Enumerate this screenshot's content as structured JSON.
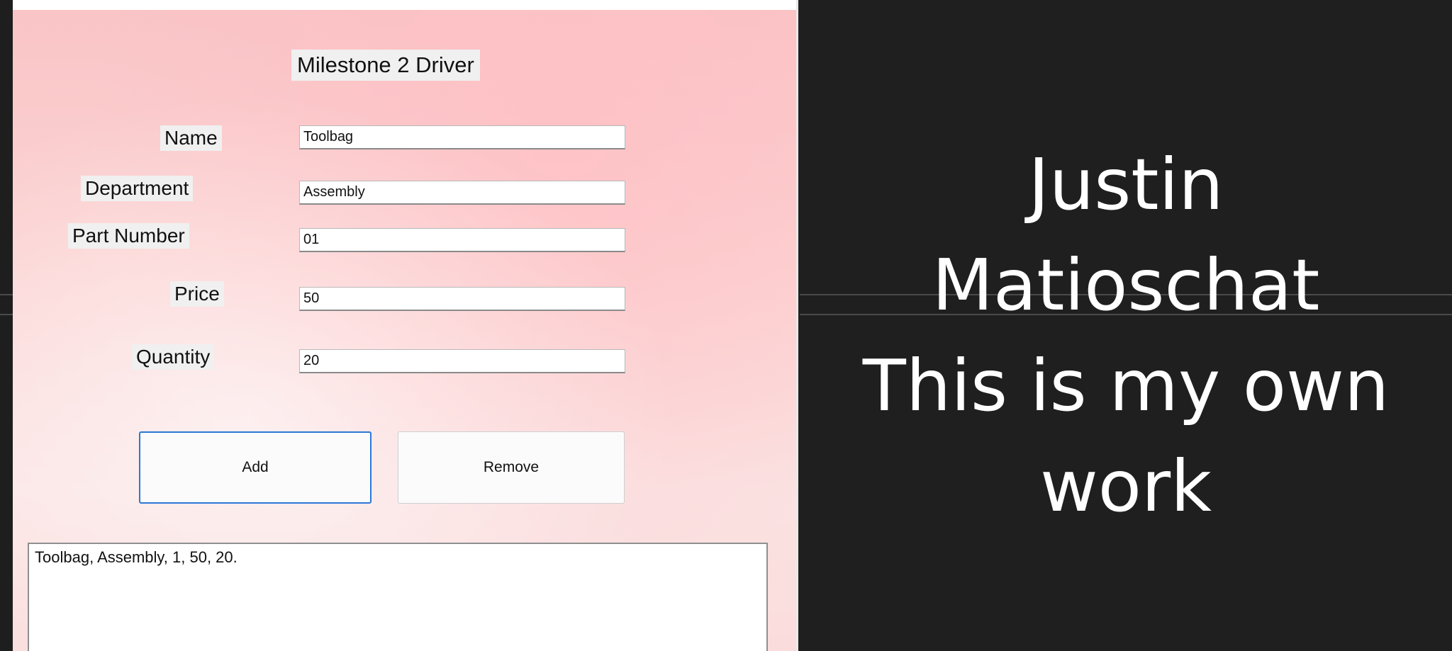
{
  "window": {
    "title": "Milestone 2 Driver"
  },
  "form": {
    "name_label": "Name",
    "name_value": "Toolbag",
    "department_label": "Department",
    "department_value": "Assembly",
    "part_number_label": "Part Number",
    "part_number_value": "01",
    "price_label": "Price",
    "price_value": "50",
    "quantity_label": "Quantity",
    "quantity_value": "20"
  },
  "buttons": {
    "add_label": "Add",
    "remove_label": "Remove"
  },
  "output": {
    "text": "Toolbag, Assembly, 1, 50, 20."
  },
  "caption": {
    "line1": "Justin",
    "line2": "Matioschat",
    "line3": "This is my own",
    "line4": "work"
  },
  "colors": {
    "window_background": "#fbd3d4",
    "caption_background": "#1f1f1f",
    "caption_text": "#ffffff",
    "focus_border": "#2b78d6"
  }
}
